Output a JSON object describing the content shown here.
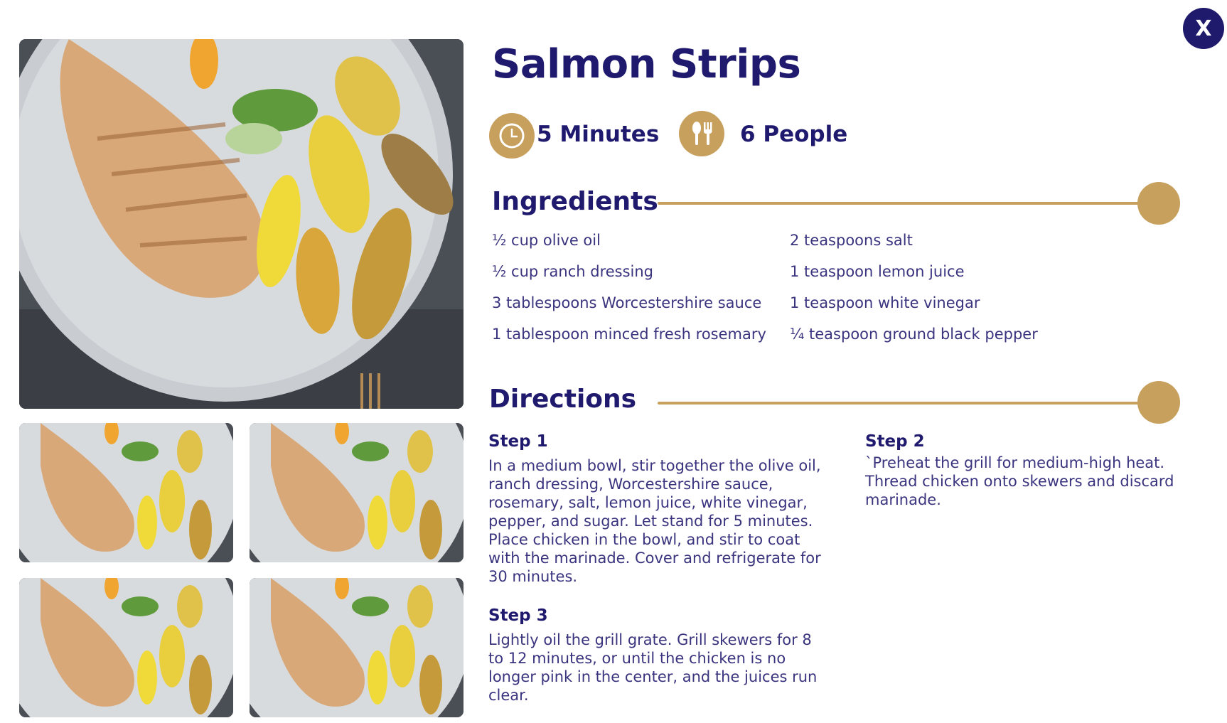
{
  "close": {
    "label": "X",
    "icon": "close-icon"
  },
  "recipe": {
    "title": "Salmon Strips"
  },
  "meta": {
    "time": {
      "icon": "clock-icon",
      "label": "5 Minutes"
    },
    "servings": {
      "icon": "utensils-icon",
      "label": "6 People"
    }
  },
  "colors": {
    "navy": "#201a6e",
    "gold": "#c7a05e",
    "text": "#3a347f"
  },
  "ingredients": {
    "heading": "Ingredients",
    "col1": [
      "½ cup olive oil",
      "½ cup ranch dressing",
      "3 tablespoons Worcestershire sauce",
      "1 tablespoon minced fresh rosemary"
    ],
    "col2": [
      "2 teaspoons salt",
      "1 teaspoon lemon juice",
      "1 teaspoon white vinegar",
      "¼ teaspoon ground black pepper"
    ]
  },
  "directions": {
    "heading": "Directions",
    "steps": [
      {
        "title": "Step 1",
        "text": "In a medium bowl, stir together the olive oil, ranch dressing, Worcestershire sauce, rosemary, salt, lemon juice, white vinegar, pepper, and sugar. Let stand for 5 minutes. Place chicken in the bowl, and stir to coat with the marinade. Cover and refrigerate for 30 minutes."
      },
      {
        "title": "Step 2",
        "text": "`Preheat the grill for medium-high heat. Thread chicken onto skewers and discard marinade."
      },
      {
        "title": "Step 3",
        "text": "Lightly oil the grill grate. Grill skewers for 8 to 12 minutes, or until the chicken is no longer pink in the center, and the juices run clear."
      }
    ]
  },
  "gallery": {
    "main": "grilled chicken with potato wedges photo",
    "thumb_count": 4
  }
}
